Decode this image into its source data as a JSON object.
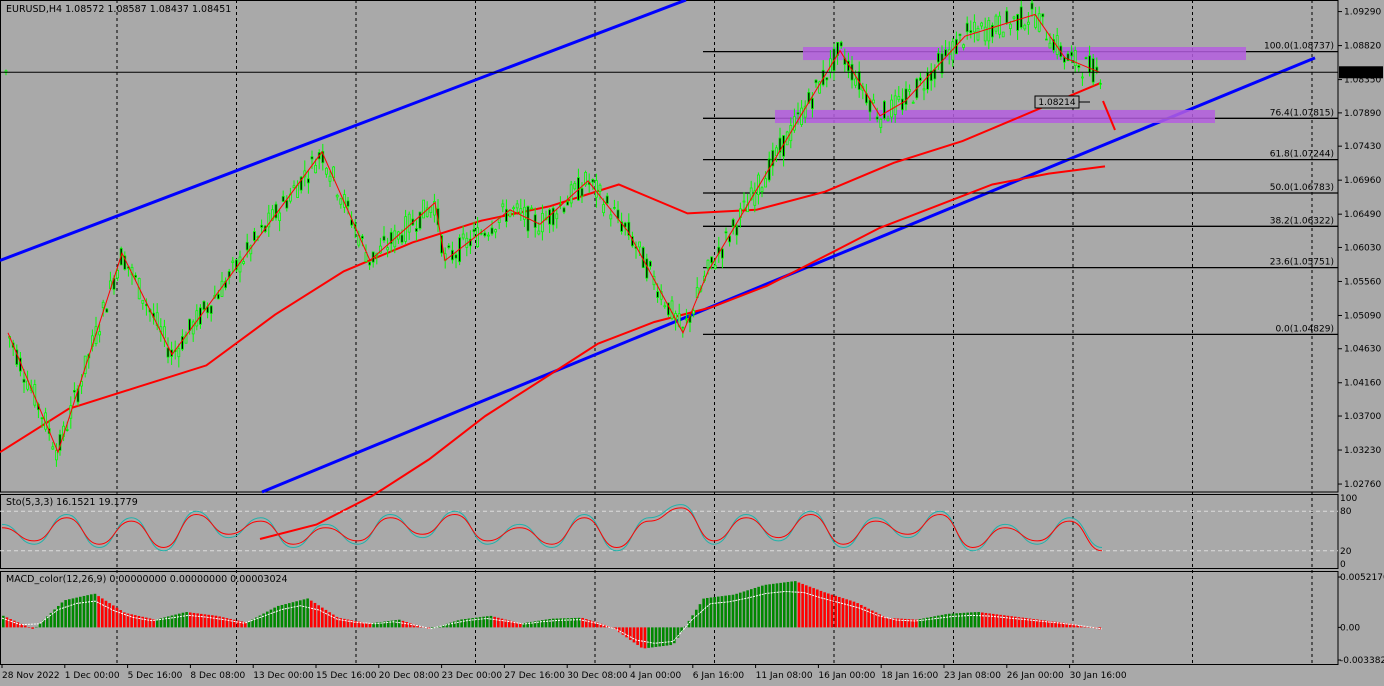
{
  "header": {
    "symbol_line": "EURUSD,H4  1.08572 1.08587 1.08437 1.08451",
    "stoch_line": "Sto(5,3,3) 16.1521 19.1779",
    "macd_line": "MACD_color(12,26,9) 0.00000000 0.00000000 0.00003024"
  },
  "colors": {
    "background": "#a9a9a9",
    "candle": "#00ff00",
    "moving_average": "#ff0000",
    "trend_channel": "#0000ff",
    "zone": "#b55ee0",
    "macd_up": "#008800",
    "macd_down": "#ff0000"
  },
  "chart_data": [
    {
      "type": "candlestick",
      "symbol": "EURUSD",
      "timeframe": "H4",
      "ohlc_last": {
        "open": 1.08572,
        "high": 1.08587,
        "low": 1.08437,
        "close": 1.08451
      },
      "y_ticks": [
        "1.09290",
        "1.08820",
        "1.08350",
        "1.07890",
        "1.07430",
        "1.06960",
        "1.06490",
        "1.06030",
        "1.05560",
        "1.05090",
        "1.04630",
        "1.04160",
        "1.03700",
        "1.03230",
        "1.02760"
      ],
      "x_ticks": [
        "28 Nov 2022",
        "1 Dec 00:00",
        "5 Dec 16:00",
        "8 Dec 08:00",
        "13 Dec 00:00",
        "15 Dec 16:00",
        "20 Dec 08:00",
        "23 Dec 00:00",
        "27 Dec 16:00",
        "30 Dec 08:00",
        "4 Jan 00:00",
        "6 Jan 16:00",
        "11 Jan 08:00",
        "16 Jan 00:00",
        "18 Jan 16:00",
        "23 Jan 08:00",
        "26 Jan 00:00",
        "30 Jan 16:00"
      ],
      "current_price_label": "1.08451",
      "marker_label": "1.08214",
      "ylim": [
        1.0265,
        1.0945
      ],
      "zigzag_points": [
        [
          1.0485,
          1.032
        ],
        [
          1.0595,
          1.045
        ],
        [
          1.0735,
          1.0585
        ],
        [
          1.067,
          1.0585
        ],
        [
          1.0695,
          1.0695
        ],
        [
          1.0555,
          1.0485
        ],
        [
          1.0875,
          1.079
        ],
        [
          1.0905,
          1.0805
        ],
        [
          1.0935,
          1.085
        ],
        [
          1.085,
          1.0845
        ]
      ],
      "fibonacci": [
        {
          "label": "100.0(1.08737)",
          "price": 1.08737
        },
        {
          "label": "76.4(1.07815)",
          "price": 1.07815
        },
        {
          "label": "61.8(1.07244)",
          "price": 1.07244
        },
        {
          "label": "50.0(1.06783)",
          "price": 1.06783
        },
        {
          "label": "38.2(1.06322)",
          "price": 1.06322
        },
        {
          "label": "23.6(1.05751)",
          "price": 1.05751
        },
        {
          "label": "0.0(1.04829)",
          "price": 1.04829
        }
      ],
      "zones": [
        {
          "from": 1.0862,
          "to": 1.088
        },
        {
          "from": 1.0775,
          "to": 1.0793
        }
      ],
      "moving_averages": [
        {
          "values": [
            1.032,
            1.038,
            1.041,
            1.044,
            1.051,
            1.057,
            1.061,
            1.064,
            1.066,
            1.069,
            1.065,
            1.0655,
            1.068,
            1.072,
            1.075,
            1.079,
            1.083
          ]
        },
        {
          "values": [
            1.02,
            1.022,
            1.026,
            1.031,
            1.037,
            1.042,
            1.047,
            1.05,
            1.052,
            1.055,
            1.059,
            1.063,
            1.066,
            1.069,
            1.0705,
            1.0715
          ]
        }
      ],
      "trendlines": [
        {
          "from": [
            0,
            1.0585
          ],
          "to": [
            686,
            1.0945
          ]
        },
        {
          "from": [
            262,
            1.0265
          ],
          "to": [
            1315,
            1.0865
          ]
        }
      ]
    },
    {
      "type": "line",
      "name": "Sto(5,3,3)",
      "ylim": [
        0,
        100
      ],
      "y_ticks": [
        "100",
        "80",
        "20",
        "0"
      ],
      "series": [
        {
          "values": [
            60,
            30,
            75,
            25,
            70,
            20,
            80,
            40,
            70,
            25,
            60,
            30,
            75,
            40,
            80,
            30,
            60,
            25,
            75,
            20,
            70,
            90,
            30,
            75,
            35,
            80,
            25,
            70,
            40,
            80,
            20,
            60,
            30,
            70,
            25
          ]
        },
        {
          "values": [
            55,
            35,
            70,
            30,
            65,
            25,
            75,
            45,
            65,
            30,
            55,
            35,
            70,
            45,
            75,
            35,
            55,
            30,
            70,
            25,
            65,
            85,
            35,
            70,
            40,
            75,
            30,
            65,
            45,
            75,
            25,
            55,
            35,
            65,
            20
          ]
        }
      ]
    },
    {
      "type": "bar",
      "name": "MACD_color(12,26,9)",
      "y_ticks": [
        "0.0052170",
        "0.00",
        "-0.003382"
      ],
      "ylim": [
        -0.00338,
        0.00522
      ],
      "values": [
        0.0012,
        -0.0002,
        0.0028,
        0.0035,
        0.0015,
        0.0008,
        0.0016,
        0.0012,
        0.0005,
        0.0022,
        0.003,
        0.001,
        0.0004,
        0.0008,
        -0.0002,
        0.0008,
        0.0012,
        0.0004,
        0.0009,
        0.001,
        0.0,
        -0.0022,
        -0.0018,
        0.003,
        0.0034,
        0.0044,
        0.0048,
        0.0036,
        0.0026,
        0.001,
        0.0008,
        0.0014,
        0.0016,
        0.0012,
        0.0008,
        0.0004,
        -0.0002
      ]
    }
  ]
}
